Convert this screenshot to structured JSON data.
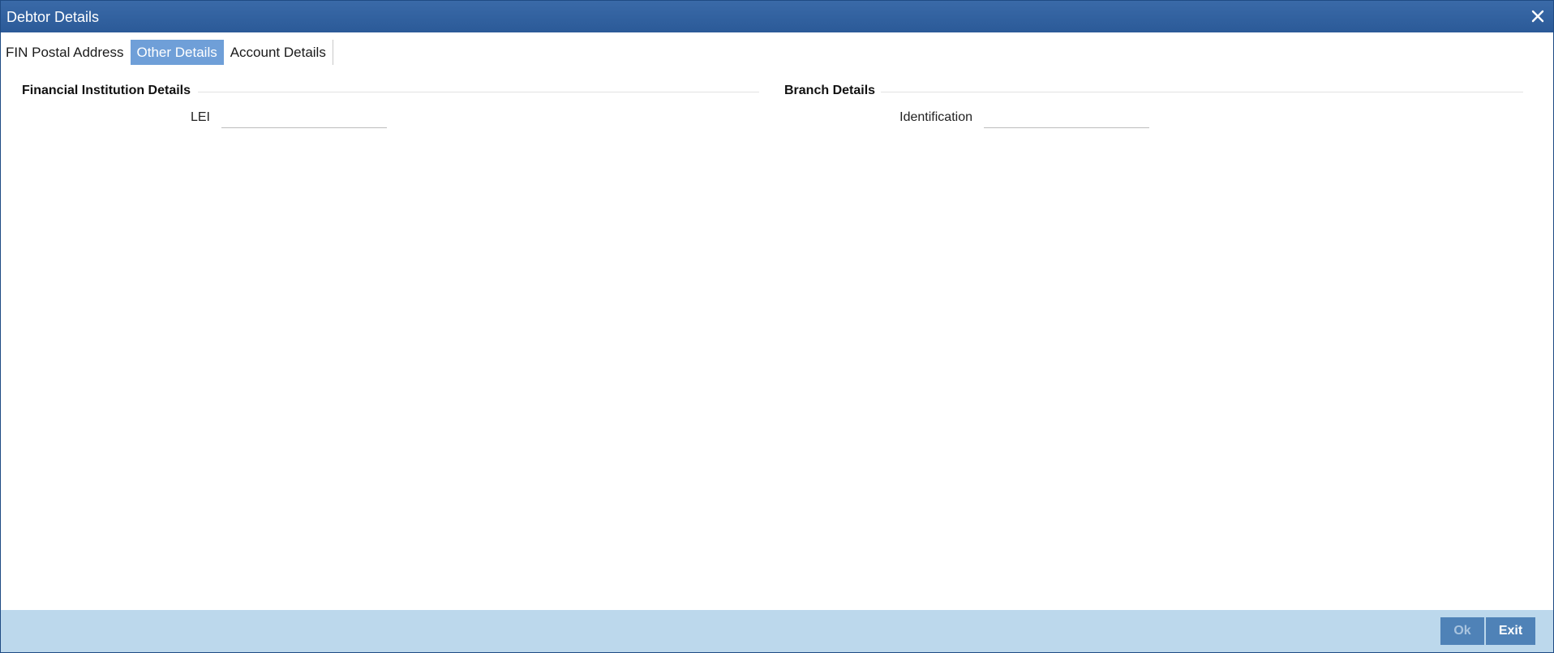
{
  "window": {
    "title": "Debtor Details"
  },
  "tabs": [
    {
      "label": "FIN Postal Address"
    },
    {
      "label": "Other Details"
    },
    {
      "label": "Account Details"
    }
  ],
  "sections": {
    "financial": {
      "title": "Financial Institution Details",
      "lei_label": "LEI",
      "lei_value": ""
    },
    "branch": {
      "title": "Branch Details",
      "identification_label": "Identification",
      "identification_value": ""
    }
  },
  "footer": {
    "ok_label": "Ok",
    "exit_label": "Exit"
  },
  "icons": {
    "close": "close-icon"
  },
  "colors": {
    "titlebar": "#2b5a98",
    "active_tab": "#6f9fd8",
    "footer": "#bcd8ec",
    "button": "#4f82b7"
  }
}
